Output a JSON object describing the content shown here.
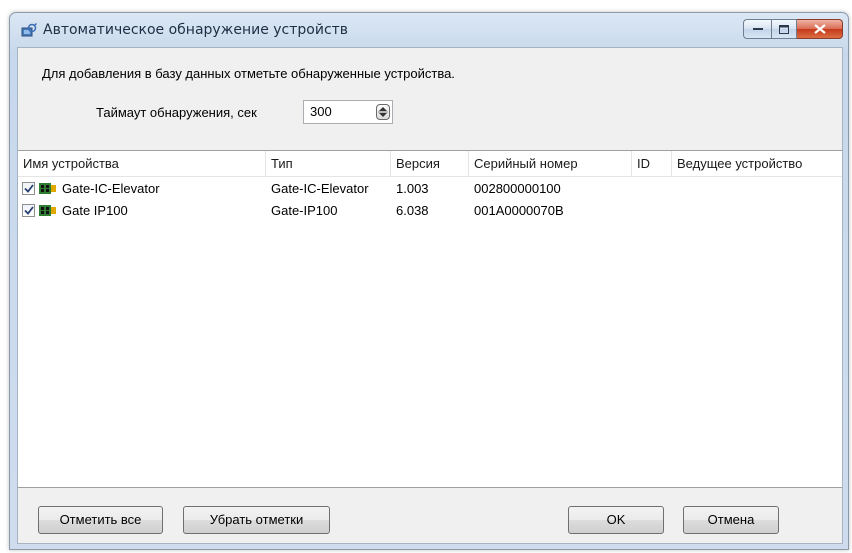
{
  "window": {
    "title": "Автоматическое обнаружение устройств"
  },
  "hint": "Для добавления в базу данных отметьте обнаруженные устройства.",
  "timeout": {
    "label": "Таймаут обнаружения, сек",
    "value": "300"
  },
  "table": {
    "columns": [
      "Имя устройства",
      "Тип",
      "Версия",
      "Серийный номер",
      "ID",
      "Ведущее устройство"
    ],
    "rows": [
      {
        "checked": true,
        "name": "Gate-IC-Elevator",
        "type": "Gate-IC-Elevator",
        "version": "1.003",
        "serial": "002800000100",
        "id": "",
        "master": ""
      },
      {
        "checked": true,
        "name": "Gate IP100",
        "type": "Gate-IP100",
        "version": "6.038",
        "serial": "001A0000070B",
        "id": "",
        "master": ""
      }
    ]
  },
  "buttons": {
    "check_all": "Отметить все",
    "uncheck_all": "Убрать отметки",
    "ok": "OK",
    "cancel": "Отмена"
  },
  "colors": {
    "title_bg": "#c8d8ec",
    "close_button": "#c4391a",
    "device_icon": "#3a8a3a"
  },
  "icons": {
    "title": "device-search-icon",
    "device": "device-board-icon",
    "check": "checkmark-icon"
  }
}
